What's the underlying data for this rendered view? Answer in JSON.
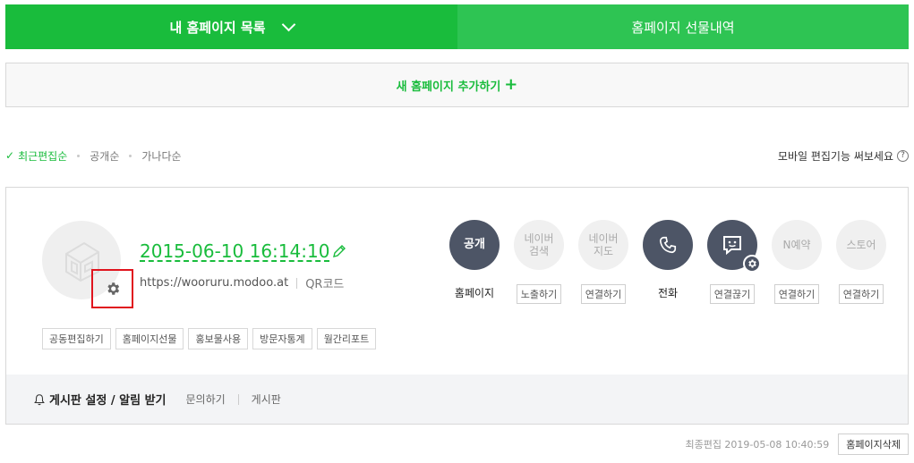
{
  "tabs": {
    "my_list": "내 홈페이지 목록",
    "gift_history": "홈페이지 선물내역"
  },
  "add_homepage": {
    "label": "새 홈페이지 추가하기",
    "icon": "plus-icon"
  },
  "sort": {
    "items": [
      {
        "label": "최근편집순",
        "active": true
      },
      {
        "label": "공개순",
        "active": false
      },
      {
        "label": "가나다순",
        "active": false
      }
    ]
  },
  "mobile_tip": {
    "label": "모바일 편집기능 써보세요",
    "help": "?"
  },
  "site": {
    "title": "2015-06-10 16:14:10",
    "url": "https://wooruru.modoo.at",
    "qr_label": "QR코드",
    "chips": [
      "공동편집하기",
      "홈페이지선물",
      "홍보물사용",
      "방문자통계",
      "월간리포트"
    ]
  },
  "services": [
    {
      "circle": "공개",
      "style": "dark",
      "label": "홈페이지",
      "action": null
    },
    {
      "circle": "네이버\n검색",
      "style": "light",
      "label": null,
      "action": "노출하기"
    },
    {
      "circle": "네이버\n지도",
      "style": "light",
      "label": null,
      "action": "연결하기"
    },
    {
      "circle": "",
      "icon": "phone-icon",
      "style": "dark",
      "label": "전화",
      "action": null
    },
    {
      "circle": "",
      "icon": "talk-icon",
      "style": "dark",
      "label": null,
      "action": "연결끊기"
    },
    {
      "circle": "N예약",
      "style": "light",
      "label": null,
      "action": "연결하기"
    },
    {
      "circle": "스토어",
      "style": "light",
      "label": null,
      "action": "연결하기"
    }
  ],
  "board": {
    "title": "게시판 설정 / 알림 받기",
    "links": [
      "문의하기",
      "게시판"
    ]
  },
  "footer": {
    "last_edit": "최종편집 2019-05-08 10:40:59",
    "delete_label": "홈페이지삭제"
  },
  "colors": {
    "brand_green": "#19bc3c",
    "tab_right": "#2ec453",
    "dark_circle": "#4d5566",
    "highlight_box": "#e0141e"
  }
}
